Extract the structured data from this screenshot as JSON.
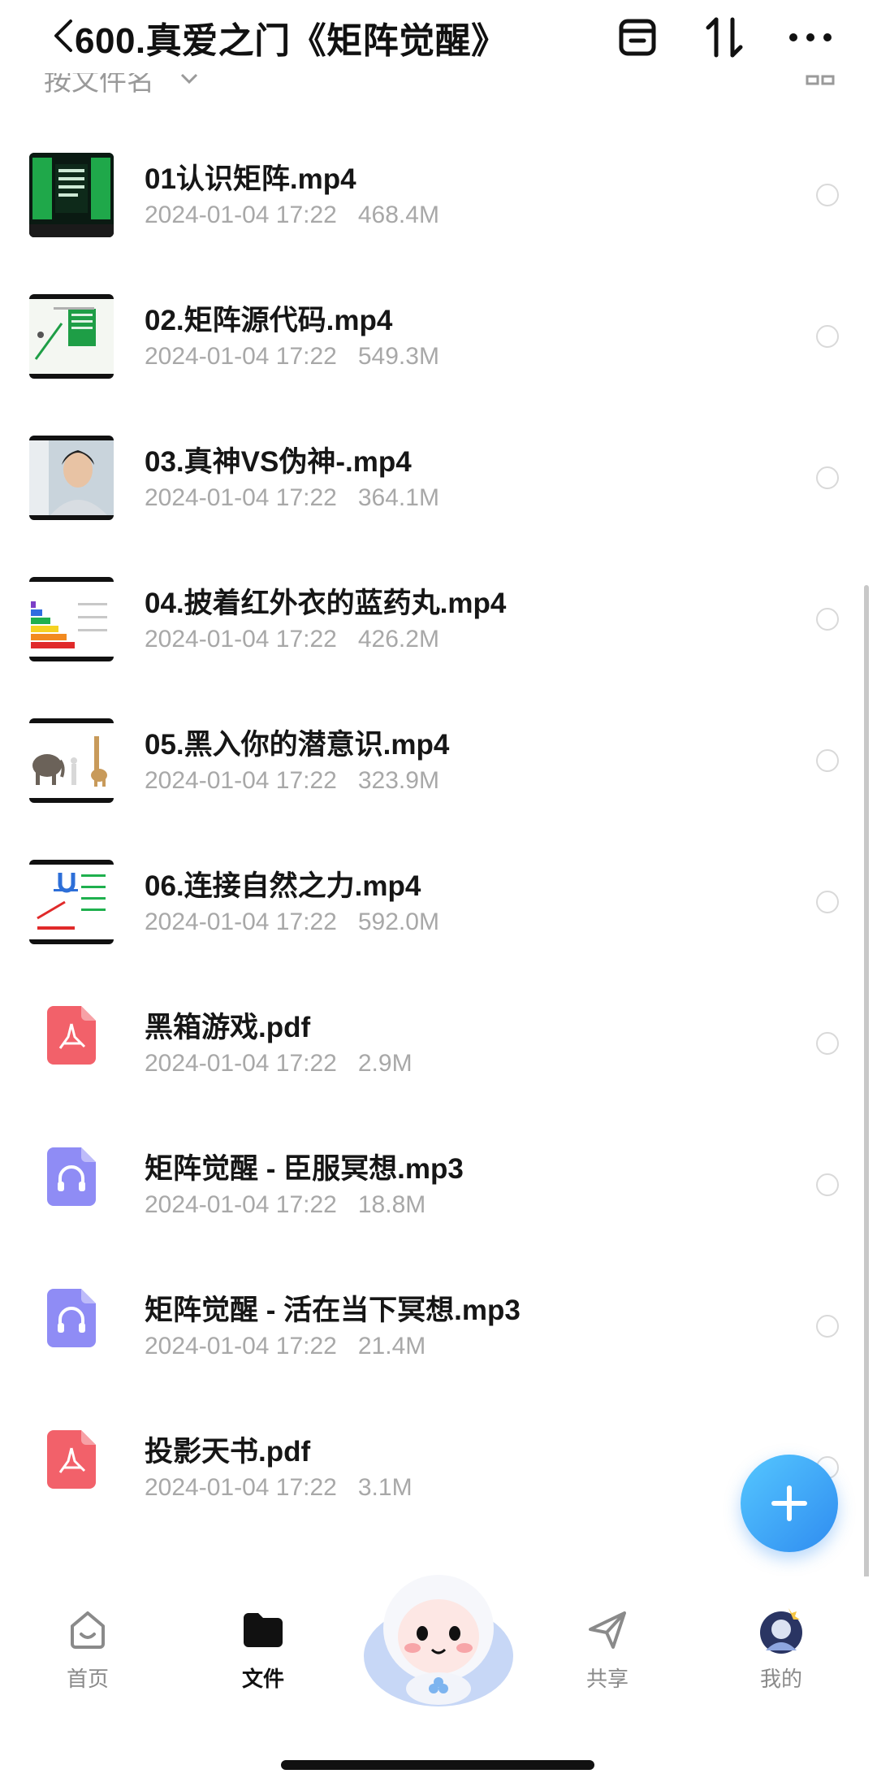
{
  "header": {
    "title": "600.真爱之门《矩阵觉醒》",
    "icons": [
      "back-icon",
      "archive-icon",
      "sort-icon",
      "more-icon"
    ]
  },
  "sort_bar": {
    "label": "按文件名",
    "icons": [
      "chevron-down-icon",
      "grid-view-icon"
    ]
  },
  "files": [
    {
      "name": "01认识矩阵.mp4",
      "date": "2024-01-04 17:22",
      "size": "468.4M",
      "type": "video"
    },
    {
      "name": "02.矩阵源代码.mp4",
      "date": "2024-01-04 17:22",
      "size": "549.3M",
      "type": "video"
    },
    {
      "name": "03.真神VS伪神-.mp4",
      "date": "2024-01-04 17:22",
      "size": "364.1M",
      "type": "video"
    },
    {
      "name": "04.披着红外衣的蓝药丸.mp4",
      "date": "2024-01-04 17:22",
      "size": "426.2M",
      "type": "video"
    },
    {
      "name": "05.黑入你的潜意识.mp4",
      "date": "2024-01-04 17:22",
      "size": "323.9M",
      "type": "video"
    },
    {
      "name": "06.连接自然之力.mp4",
      "date": "2024-01-04 17:22",
      "size": "592.0M",
      "type": "video"
    },
    {
      "name": "黑箱游戏.pdf",
      "date": "2024-01-04 17:22",
      "size": "2.9M",
      "type": "pdf"
    },
    {
      "name": "矩阵觉醒 - 臣服冥想.mp3",
      "date": "2024-01-04 17:22",
      "size": "18.8M",
      "type": "audio"
    },
    {
      "name": "矩阵觉醒 - 活在当下冥想.mp3",
      "date": "2024-01-04 17:22",
      "size": "21.4M",
      "type": "audio"
    },
    {
      "name": "投影天书.pdf",
      "date": "2024-01-04 17:22",
      "size": "3.1M",
      "type": "pdf"
    }
  ],
  "fab": {
    "icon": "plus-icon"
  },
  "nav": {
    "home": "首页",
    "files": "文件",
    "share": "共享",
    "mine": "我的"
  },
  "colors": {
    "pdf": "#f2616a",
    "audio": "#8f8cf5",
    "fab": "#3aa6f5"
  }
}
